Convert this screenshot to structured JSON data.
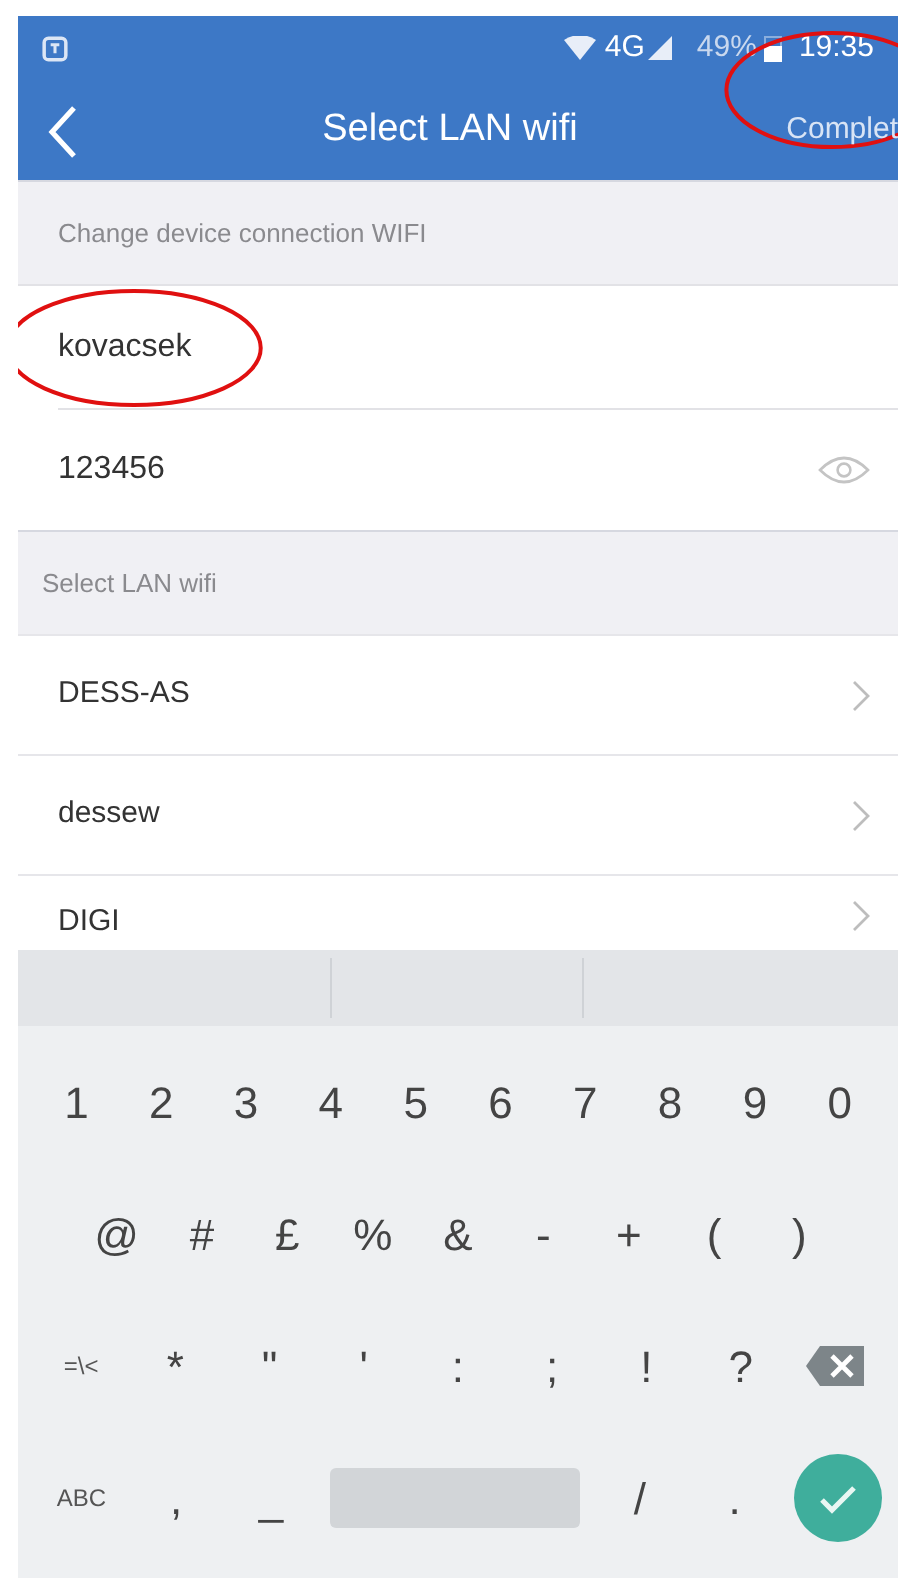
{
  "status_bar": {
    "network": "4G",
    "battery": "49%",
    "time": "19:35",
    "time_circled": true
  },
  "nav_bar": {
    "title": "Select LAN wifi",
    "action": "Complet"
  },
  "sections": [
    {
      "header": "Change device connection WIFI"
    },
    {
      "header": "Select LAN wifi"
    }
  ],
  "ssid_field": {
    "value": "kovacsek",
    "circled": true
  },
  "password_field": {
    "value": "123456"
  },
  "wifi_list": [
    {
      "name": "DESS-AS"
    },
    {
      "name": "dessew"
    },
    {
      "name": "DIGI"
    }
  ],
  "keyboard": {
    "rows": [
      [
        {
          "kind": "char",
          "label": "1"
        },
        {
          "kind": "char",
          "label": "2"
        },
        {
          "kind": "char",
          "label": "3"
        },
        {
          "kind": "char",
          "label": "4"
        },
        {
          "kind": "char",
          "label": "5"
        },
        {
          "kind": "char",
          "label": "6"
        },
        {
          "kind": "char",
          "label": "7"
        },
        {
          "kind": "char",
          "label": "8"
        },
        {
          "kind": "char",
          "label": "9"
        },
        {
          "kind": "char",
          "label": "0"
        }
      ],
      [
        {
          "kind": "char",
          "label": "@"
        },
        {
          "kind": "char",
          "label": "#"
        },
        {
          "kind": "char",
          "label": "£"
        },
        {
          "kind": "char",
          "label": "%"
        },
        {
          "kind": "char",
          "label": "&"
        },
        {
          "kind": "char",
          "label": "-"
        },
        {
          "kind": "char",
          "label": "+"
        },
        {
          "kind": "char",
          "label": "("
        },
        {
          "kind": "char",
          "label": ")"
        }
      ],
      [
        {
          "kind": "small",
          "label": "=\\<"
        },
        {
          "kind": "char",
          "label": "*"
        },
        {
          "kind": "char",
          "label": "\""
        },
        {
          "kind": "char",
          "label": "'"
        },
        {
          "kind": "char",
          "label": ":"
        },
        {
          "kind": "char",
          "label": ";"
        },
        {
          "kind": "char",
          "label": "!"
        },
        {
          "kind": "char",
          "label": "?"
        },
        {
          "kind": "backspace"
        }
      ],
      [
        {
          "kind": "small",
          "label": "ABC"
        },
        {
          "kind": "char",
          "label": ","
        },
        {
          "kind": "char",
          "label": "_"
        },
        {
          "kind": "space"
        },
        {
          "kind": "char",
          "label": "/"
        },
        {
          "kind": "char",
          "label": "."
        },
        {
          "kind": "done"
        }
      ]
    ]
  }
}
